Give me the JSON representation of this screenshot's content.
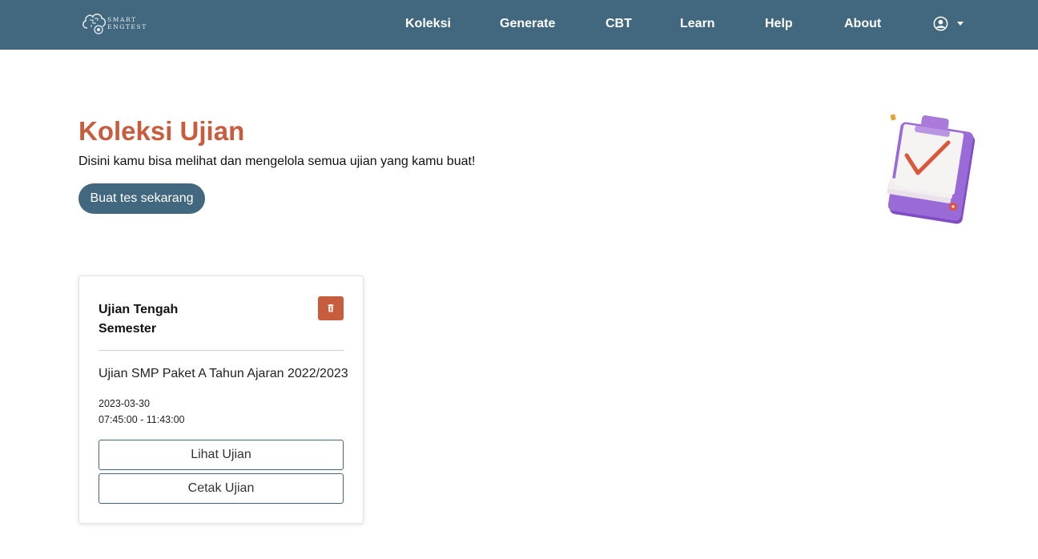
{
  "navbar": {
    "brand": {
      "line1": "SMART",
      "line2": "ENGTEST"
    },
    "links": [
      {
        "label": "Koleksi"
      },
      {
        "label": "Generate"
      },
      {
        "label": "CBT"
      },
      {
        "label": "Learn"
      },
      {
        "label": "Help"
      },
      {
        "label": "About"
      }
    ],
    "user_icon": "user-circle-icon"
  },
  "hero": {
    "title": "Koleksi Ujian",
    "subtitle": "Disini kamu bisa melihat dan mengelola semua ujian yang kamu buat!",
    "cta_label": "Buat tes sekarang",
    "illustration": "clipboard-check-illustration"
  },
  "exams": [
    {
      "title": "Ujian Tengah Semester",
      "description": "Ujian SMP Paket A Tahun Ajaran 2022/2023",
      "date": "2023-03-30",
      "time": "07:45:00 - 11:43:00",
      "view_label": "Lihat Ujian",
      "print_label": "Cetak Ujian",
      "delete_icon": "trash-icon"
    }
  ],
  "colors": {
    "primary": "#41687e",
    "accent": "#c85d3d",
    "illustration_board": "#9a6ad6"
  }
}
